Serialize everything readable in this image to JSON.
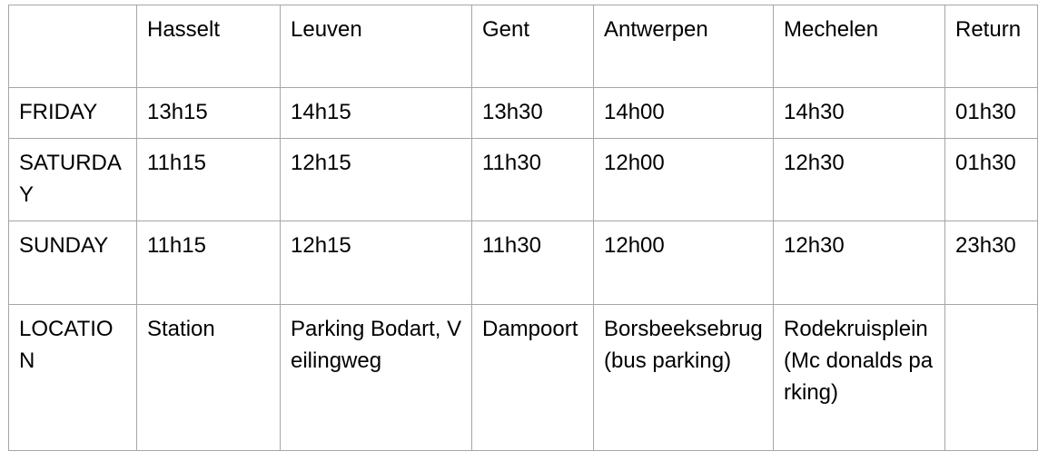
{
  "table": {
    "header": [
      "",
      "Hasselt",
      "Leuven",
      "Gent",
      "Antwerpen",
      "Mechelen",
      "Return"
    ],
    "rows": [
      {
        "label": "FRIDAY",
        "cells": [
          "13h15",
          "14h15",
          "13h30",
          "14h00",
          "14h30",
          "01h30"
        ]
      },
      {
        "label": "SATURDAY",
        "cells": [
          "11h15",
          "12h15",
          "11h30",
          "12h00",
          "12h30",
          "01h30"
        ]
      },
      {
        "label": "SUNDAY",
        "cells": [
          "11h15",
          "12h15",
          "11h30",
          "12h00",
          "12h30",
          "23h30"
        ]
      },
      {
        "label": "LOCATION",
        "cells": [
          "Station",
          "Parking Bodart, Veilingweg",
          "Dampoort",
          "Borsbeeksebrug (bus parking)",
          "Rodekruisplein (Mc donalds parking)",
          ""
        ]
      }
    ]
  }
}
